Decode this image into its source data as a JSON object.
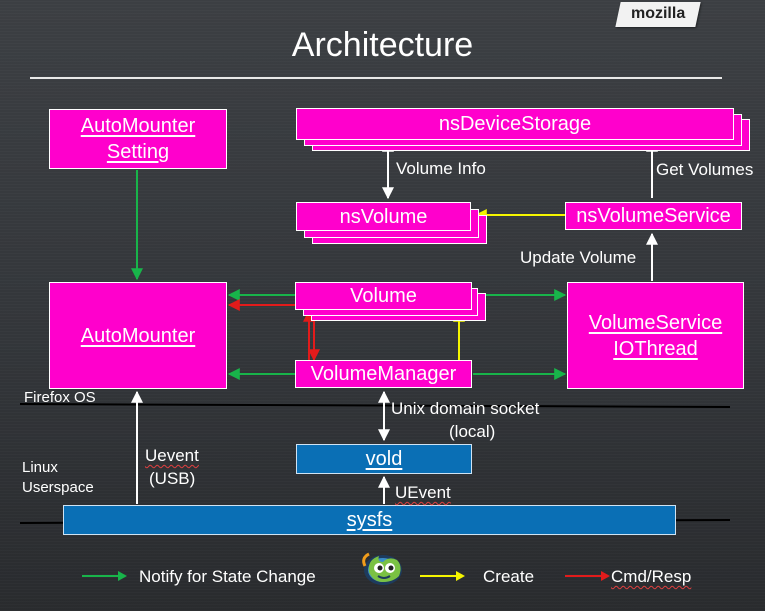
{
  "header": {
    "logo_text": "mozilla",
    "title": "Architecture"
  },
  "boxes": {
    "automounter_setting": "AutoMounter\nSetting",
    "ns_device_storage": "nsDeviceStorage",
    "ns_volume": "nsVolume",
    "ns_volume_service": "nsVolumeService",
    "automounter": "AutoMounter",
    "volume": "Volume",
    "volume_service_iothread": "VolumeService\nIOThread",
    "volume_manager": "VolumeManager",
    "vold": "vold",
    "sysfs": "sysfs"
  },
  "labels": {
    "volume_info": "Volume Info",
    "get_volumes": "Get Volumes",
    "update_volume": "Update Volume",
    "firefox_os": "Firefox OS",
    "unix_socket_line1": "Unix  domain socket",
    "unix_socket_line2": "(local)",
    "uevent_usb_line1": "Uevent",
    "uevent_usb_line2": "(USB)",
    "linux_userspace_line1": "Linux",
    "linux_userspace_line2": "Userspace",
    "uevent_vold": "UEvent"
  },
  "legend": {
    "items": [
      {
        "label": "Notify for State Change",
        "color": "#18b44a"
      },
      {
        "label": "Create",
        "color": "#f5f500"
      },
      {
        "label": "Cmd/Resp",
        "color": "#e21b1b"
      }
    ],
    "mascot_icon": "firefox-os-mascot-icon"
  },
  "colors": {
    "component_fill": "#ff00cc",
    "kernel_fill": "#0a6fb5",
    "notify_arrow": "#18b44a",
    "create_arrow": "#f5f500",
    "cmd_arrow": "#e21b1b",
    "data_arrow": "#ffffff"
  }
}
